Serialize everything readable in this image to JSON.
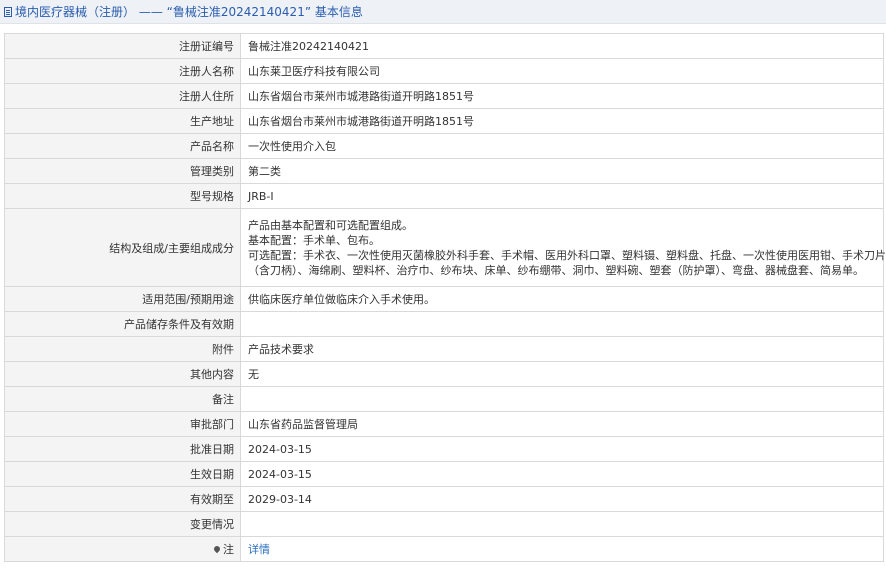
{
  "header": {
    "title": "境内医疗器械（注册） —— “鲁械注准20242140421” 基本信息"
  },
  "rows": [
    {
      "label": "注册证编号",
      "value": "鲁械注准20242140421"
    },
    {
      "label": "注册人名称",
      "value": "山东莱卫医疗科技有限公司"
    },
    {
      "label": "注册人住所",
      "value": "山东省烟台市莱州市城港路街道开明路1851号"
    },
    {
      "label": "生产地址",
      "value": "山东省烟台市莱州市城港路街道开明路1851号"
    },
    {
      "label": "产品名称",
      "value": "一次性使用介入包"
    },
    {
      "label": "管理类别",
      "value": "第二类"
    },
    {
      "label": "型号规格",
      "value": "JRB-I"
    },
    {
      "label": "结构及组成/主要组成成分",
      "lines": [
        "产品由基本配置和可选配置组成。",
        "基本配置：手术单、包布。",
        "可选配置：手术衣、一次性使用灭菌橡胶外科手套、手术帽、医用外科口罩、塑料镊、塑料盘、托盘、一次性使用医用钳、手术刀片",
        "（含刀柄）、海绵刷、塑料杯、治疗巾、纱布块、床单、纱布绷带、洞巾、塑料碗、塑套（防护罩）、弯盘、器械盘套、简易单。"
      ]
    },
    {
      "label": "适用范围/预期用途",
      "value": "供临床医疗单位做临床介入手术使用。"
    },
    {
      "label": "产品储存条件及有效期",
      "value": ""
    },
    {
      "label": "附件",
      "value": "产品技术要求"
    },
    {
      "label": "其他内容",
      "value": "无"
    },
    {
      "label": "备注",
      "value": ""
    },
    {
      "label": "审批部门",
      "value": "山东省药品监督管理局"
    },
    {
      "label": "批准日期",
      "value": "2024-03-15"
    },
    {
      "label": "生效日期",
      "value": "2024-03-15"
    },
    {
      "label": "有效期至",
      "value": "2029-03-14"
    },
    {
      "label": "变更情况",
      "value": ""
    },
    {
      "label": "注",
      "value": "详情",
      "icon": "pin-icon"
    }
  ]
}
